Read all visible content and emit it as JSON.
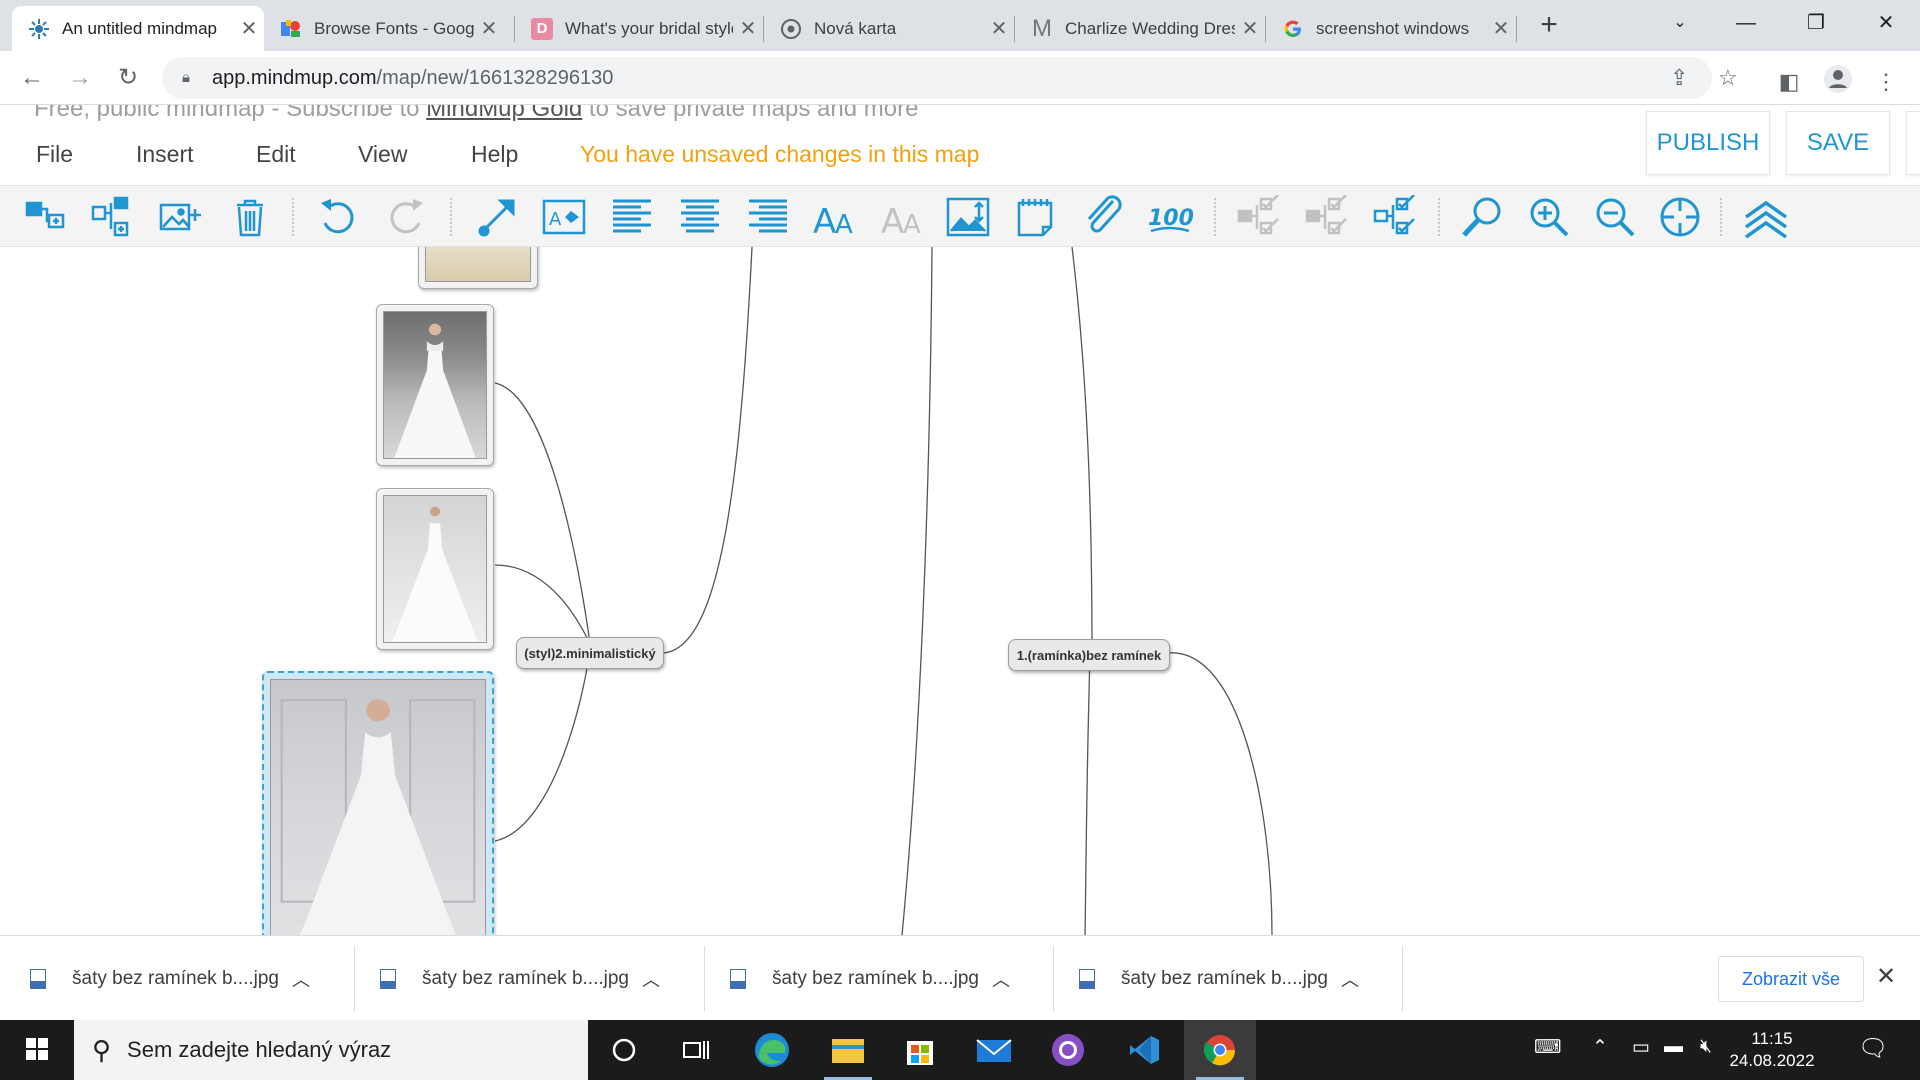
{
  "browser": {
    "tabs": [
      {
        "title": "An untitled mindmap",
        "active": true
      },
      {
        "title": "Browse Fonts - Google Fonts",
        "active": false
      },
      {
        "title": "What's your bridal style",
        "active": false
      },
      {
        "title": "Nová karta",
        "active": false
      },
      {
        "title": "Charlize Wedding Dress",
        "active": false
      },
      {
        "title": "screenshot windows",
        "active": false
      }
    ],
    "new_tab_label": "+",
    "url_host": "app.mindmup.com",
    "url_path": "/map/new/1661328296130"
  },
  "app": {
    "notice_text_a": "Free, public mindmap - Subscribe to ",
    "notice_link": "MindMup Gold",
    "notice_text_b": " to save private maps and more",
    "menu": [
      "File",
      "Insert",
      "Edit",
      "View",
      "Help"
    ],
    "unsaved_message": "You have unsaved changes in this map",
    "publish_label": "PUBLISH",
    "save_label": "SAVE",
    "accent_color": "#1f95d1",
    "warning_color": "#f2a20b"
  },
  "toolbar_icons": [
    "add-child-node-icon",
    "add-sibling-node-icon",
    "insert-image-icon",
    "delete-icon",
    "undo-icon",
    "redo-icon",
    "connect-icon",
    "node-color-icon",
    "align-left-icon",
    "align-center-icon",
    "align-right-icon",
    "increase-font-icon",
    "decrease-font-icon",
    "image-resize-icon",
    "note-icon",
    "link-icon",
    "progress-icon",
    "collapse-icon",
    "expand-icon",
    "select-all-icon",
    "search-icon",
    "zoom-in-icon",
    "zoom-out-icon",
    "center-map-icon",
    "collapse-toolbar-icon"
  ],
  "map": {
    "nodes": [
      {
        "label": "(styl)2.minimalistický"
      },
      {
        "label": "1.(ramínka)bez ramínek"
      }
    ]
  },
  "downloads": {
    "items": [
      {
        "file": "šaty bez ramínek b....jpg"
      },
      {
        "file": "šaty bez ramínek b....jpg"
      },
      {
        "file": "šaty bez ramínek b....jpg"
      },
      {
        "file": "šaty bez ramínek b....jpg"
      }
    ],
    "show_all_label": "Zobrazit vše"
  },
  "taskbar": {
    "search_placeholder": "Sem zadejte hledaný výraz",
    "time": "11:15",
    "date": "24.08.2022"
  }
}
